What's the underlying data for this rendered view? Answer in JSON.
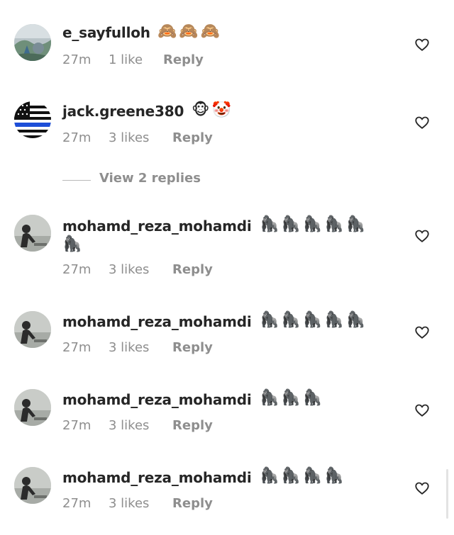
{
  "comments": [
    {
      "username": "e_sayfulloh",
      "emojis": "🙈🙈🙈",
      "time": "27m",
      "likes": "1 like",
      "reply": "Reply",
      "avatar": "landscape-photo"
    },
    {
      "username": "jack.greene380",
      "emojis": "🐵🤡",
      "time": "27m",
      "likes": "3 likes",
      "reply": "Reply",
      "avatar": "thin-blue-line-flag"
    },
    {
      "username": "mohamd_reza_mohamdi",
      "emojis": "🦍🦍🦍🦍🦍",
      "emojis_line2": "🦍",
      "time": "27m",
      "likes": "3 likes",
      "reply": "Reply",
      "avatar": "silhouette-photo"
    },
    {
      "username": "mohamd_reza_mohamdi",
      "emojis": "🦍🦍🦍🦍🦍",
      "time": "27m",
      "likes": "3 likes",
      "reply": "Reply",
      "avatar": "silhouette-photo"
    },
    {
      "username": "mohamd_reza_mohamdi",
      "emojis": "🦍🦍🦍",
      "time": "27m",
      "likes": "3 likes",
      "reply": "Reply",
      "avatar": "silhouette-photo"
    },
    {
      "username": "mohamd_reza_mohamdi",
      "emojis": "🦍🦍🦍🦍",
      "time": "27m",
      "likes": "3 likes",
      "reply": "Reply",
      "avatar": "silhouette-photo"
    }
  ],
  "view_replies": "View 2 replies",
  "icons": {
    "like": "heart-outline-icon"
  },
  "colors": {
    "text_primary": "#262626",
    "text_secondary": "#8e8e8e",
    "flag_blue": "#1d4ed8"
  }
}
